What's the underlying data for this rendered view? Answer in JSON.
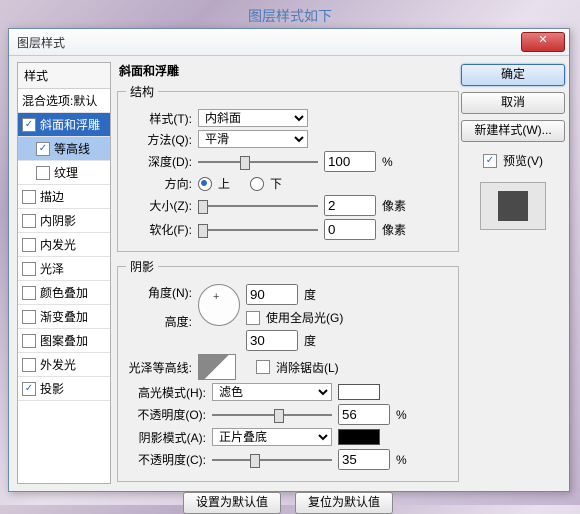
{
  "caption": "图层样式如下",
  "dialog": {
    "title": "图层样式",
    "close": "✕"
  },
  "styles": {
    "header": "样式",
    "blend": "混合选项:默认",
    "items": [
      {
        "label": "斜面和浮雕",
        "checked": true,
        "selected": true
      },
      {
        "label": "等高线",
        "checked": true,
        "sub": true,
        "selected": true
      },
      {
        "label": "纹理",
        "checked": false,
        "sub": true
      },
      {
        "label": "描边",
        "checked": false
      },
      {
        "label": "内阴影",
        "checked": false
      },
      {
        "label": "内发光",
        "checked": false
      },
      {
        "label": "光泽",
        "checked": false
      },
      {
        "label": "颜色叠加",
        "checked": false
      },
      {
        "label": "渐变叠加",
        "checked": false
      },
      {
        "label": "图案叠加",
        "checked": false
      },
      {
        "label": "外发光",
        "checked": false
      },
      {
        "label": "投影",
        "checked": true
      }
    ]
  },
  "panel_title": "斜面和浮雕",
  "struct": {
    "legend": "结构",
    "style_label": "样式(T):",
    "style_value": "内斜面",
    "tech_label": "方法(Q):",
    "tech_value": "平滑",
    "depth_label": "深度(D):",
    "depth_value": "100",
    "depth_unit": "%",
    "dir_label": "方向:",
    "dir_up": "上",
    "dir_down": "下",
    "size_label": "大小(Z):",
    "size_value": "2",
    "size_unit": "像素",
    "soften_label": "软化(F):",
    "soften_value": "0",
    "soften_unit": "像素"
  },
  "shade": {
    "legend": "阴影",
    "angle_label": "角度(N):",
    "angle_value": "90",
    "angle_unit": "度",
    "global_label": "使用全局光(G)",
    "altitude_label": "高度:",
    "altitude_value": "30",
    "altitude_unit": "度",
    "gloss_label": "光泽等高线:",
    "anti_label": "消除锯齿(L)",
    "hmode_label": "高光模式(H):",
    "hmode_value": "滤色",
    "hopa_label": "不透明度(O):",
    "hopa_value": "56",
    "hopa_unit": "%",
    "smode_label": "阴影模式(A):",
    "smode_value": "正片叠底",
    "sopa_label": "不透明度(C):",
    "sopa_value": "35",
    "sopa_unit": "%",
    "highlight_color": "#ffffff",
    "shadow_color": "#000000"
  },
  "bottom": {
    "make_default": "设置为默认值",
    "reset_default": "复位为默认值"
  },
  "actions": {
    "ok": "确定",
    "cancel": "取消",
    "new_style": "新建样式(W)...",
    "preview": "预览(V)"
  }
}
